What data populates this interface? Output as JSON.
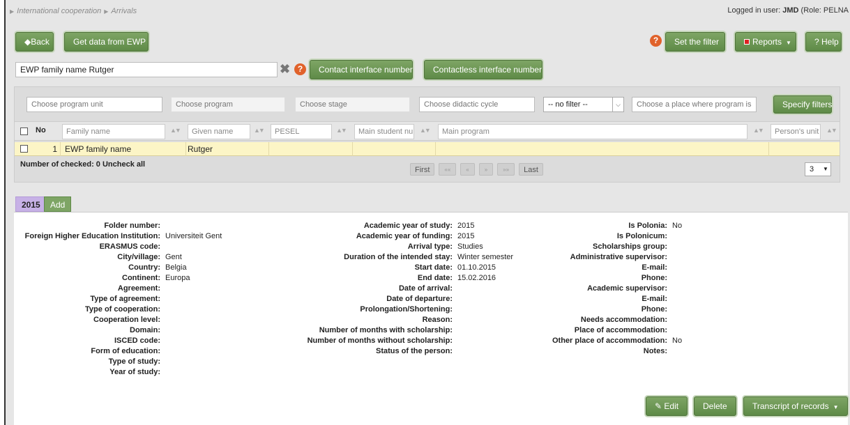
{
  "breadcrumb": [
    "International cooperation",
    "Arrivals"
  ],
  "login": {
    "prefix": "Logged in user: ",
    "user": "JMD",
    "suffix": " (Role: PELNA"
  },
  "toolbar": {
    "back_label": "Back",
    "get_data_label": "Get data from EWP",
    "set_filter_label": "Set the filter",
    "reports_label": "Reports",
    "help_label": "? Help"
  },
  "search": {
    "value": "EWP family name Rutger",
    "contact_label": "Contact interface number",
    "contactless_label": "Contactless interface number"
  },
  "filters": {
    "program_unit_placeholder": "Choose program unit",
    "program_placeholder": "Choose program",
    "stage_placeholder": "Choose stage",
    "didactic_cycle_placeholder": "Choose didactic cycle",
    "no_filter": "-- no filter --",
    "place_placeholder": "Choose a place where program is t",
    "specify_label": "Specify filters"
  },
  "grid": {
    "headers": {
      "no": "No",
      "family_name": "Family name",
      "given_name": "Given name",
      "pesel": "PESEL",
      "main_student": "Main student nu",
      "main_program": "Main program",
      "persons_unit": "Person's unit"
    },
    "rows": [
      {
        "no": "1",
        "family_name": "EWP family name",
        "given_name": "Rutger",
        "pesel": "",
        "main_student": "",
        "main_program": "",
        "persons_unit": ""
      }
    ],
    "checked_info": "Number of checked: 0 Uncheck all",
    "pager": {
      "first": "First",
      "prev_prev": "««",
      "prev": "«",
      "next": "»",
      "next_next": "»»",
      "last": "Last"
    },
    "page_size": "3"
  },
  "tabs": {
    "year": "2015",
    "add": "Add"
  },
  "details": {
    "col1": [
      {
        "label": "Folder number:",
        "value": ""
      },
      {
        "label": "Foreign Higher Education Institution:",
        "value": "Universiteit Gent"
      },
      {
        "label": "ERASMUS code:",
        "value": ""
      },
      {
        "label": "City/village:",
        "value": "Gent"
      },
      {
        "label": "Country:",
        "value": "Belgia"
      },
      {
        "label": "Continent:",
        "value": "Europa"
      },
      {
        "label": "Agreement:",
        "value": ""
      },
      {
        "label": "Type of agreement:",
        "value": ""
      },
      {
        "label": "Type of cooperation:",
        "value": ""
      },
      {
        "label": "Cooperation level:",
        "value": ""
      },
      {
        "label": "Domain:",
        "value": ""
      },
      {
        "label": "ISCED code:",
        "value": ""
      },
      {
        "label": "Form of education:",
        "value": ""
      },
      {
        "label": "Type of study:",
        "value": ""
      },
      {
        "label": "Year of study:",
        "value": ""
      }
    ],
    "col2": [
      {
        "label": "Academic year of study:",
        "value": "2015"
      },
      {
        "label": "Academic year of funding:",
        "value": "2015"
      },
      {
        "label": "Arrival type:",
        "value": "Studies"
      },
      {
        "label": "Duration of the intended stay:",
        "value": "Winter semester"
      },
      {
        "label": "Start date:",
        "value": "01.10.2015"
      },
      {
        "label": "End date:",
        "value": "15.02.2016"
      },
      {
        "label": "Date of arrival:",
        "value": ""
      },
      {
        "label": "Date of departure:",
        "value": ""
      },
      {
        "label": "Prolongation/Shortening:",
        "value": ""
      },
      {
        "label": "Reason:",
        "value": ""
      },
      {
        "label": "Number of months with scholarship:",
        "value": ""
      },
      {
        "label": "Number of months without scholarship:",
        "value": ""
      },
      {
        "label": "Status of the person:",
        "value": ""
      }
    ],
    "col3": [
      {
        "label": "Is Polonia:",
        "value": "No"
      },
      {
        "label": "Is Polonicum:",
        "value": ""
      },
      {
        "label": "Scholarships group:",
        "value": ""
      },
      {
        "label": "Administrative supervisor:",
        "value": ""
      },
      {
        "label": "E-mail:",
        "value": ""
      },
      {
        "label": "Phone:",
        "value": ""
      },
      {
        "label": "Academic supervisor:",
        "value": ""
      },
      {
        "label": "E-mail:",
        "value": ""
      },
      {
        "label": "Phone:",
        "value": ""
      },
      {
        "label": "Needs accommodation:",
        "value": ""
      },
      {
        "label": "Place of accommodation:",
        "value": ""
      },
      {
        "label": "Other place of accommodation:",
        "value": "No"
      },
      {
        "label": "Notes:",
        "value": ""
      }
    ]
  },
  "actions": {
    "edit_label": "Edit",
    "delete_label": "Delete",
    "transcript_label": "Transcript of records"
  }
}
